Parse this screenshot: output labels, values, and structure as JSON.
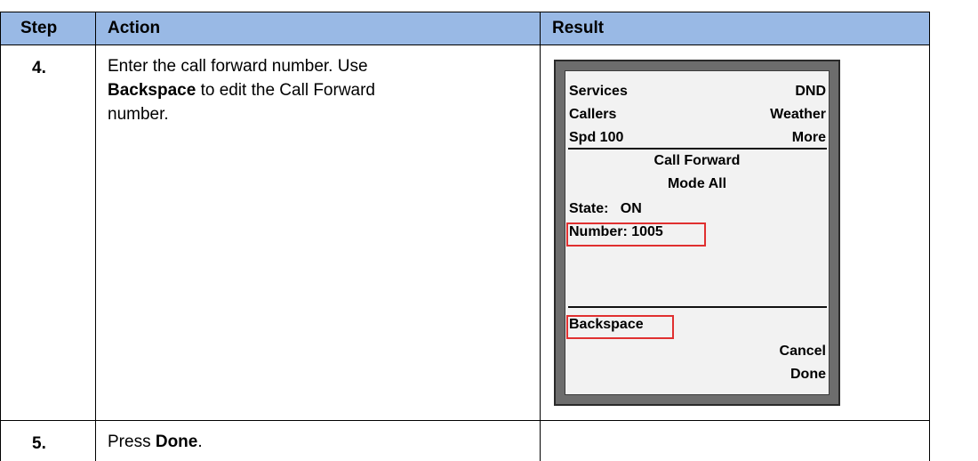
{
  "table": {
    "headers": {
      "step": "Step",
      "action": "Action",
      "result": "Result"
    },
    "row4": {
      "step": "4.",
      "action_part1": "Enter the call forward number. Use",
      "action_bold": "Backspace",
      "action_part2": " to edit the Call Forward",
      "action_part3": "number."
    },
    "row5": {
      "step": "5.",
      "action_part1": "Press ",
      "action_bold": "Done",
      "action_part2": "."
    }
  },
  "phone_screen": {
    "row1_left": "Services",
    "row1_right": "DND",
    "row2_left": "Callers",
    "row2_right": "Weather",
    "row3_left": "Spd 100",
    "row3_right": "More",
    "title1": "Call Forward",
    "title2": "Mode All",
    "state": "State:   ON",
    "number": "Number: 1005",
    "softkey_backspace": "Backspace",
    "softkey_cancel": "Cancel",
    "softkey_done": "Done"
  },
  "colors": {
    "header_bg": "#99b9e5",
    "highlight": "#e03030",
    "phone_frame": "#6d6d6d",
    "lcd_bg": "#f2f2f2"
  }
}
